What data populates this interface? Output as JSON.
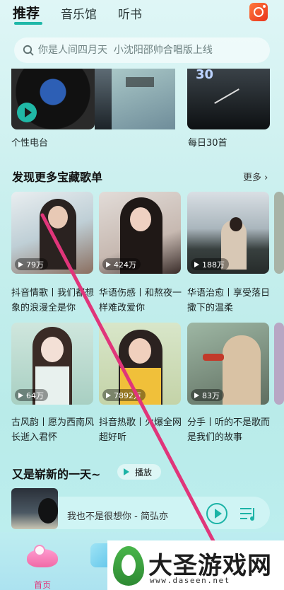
{
  "tabs": [
    "推荐",
    "音乐馆",
    "听书"
  ],
  "search": {
    "placeholder": "你是人间四月天  小沈阳邵帅合唱版上线"
  },
  "top_items": [
    {
      "label": "个性电台"
    },
    {
      "label": "每日30首",
      "cover_text": "30"
    }
  ],
  "section": {
    "title": "发现更多宝藏歌单",
    "more": "更多"
  },
  "playlists": [
    {
      "count": "79万",
      "title": "抖音情歌丨我们都想象的浪漫全是你"
    },
    {
      "count": "424万",
      "title": "华语伤感丨和熬夜一样难改爱你"
    },
    {
      "count": "188万",
      "title": "华语治愈丨享受落日撒下的温柔"
    },
    {
      "count": "64万",
      "title": "古风韵丨愿为西南风 长逝入君怀"
    },
    {
      "count": "7892万",
      "title": "抖音热歌丨火爆全网超好听"
    },
    {
      "count": "83万",
      "title": "分手丨听的不是歌而是我们的故事"
    }
  ],
  "section2": {
    "title": "又是崭新的一天~",
    "play": "播放"
  },
  "player": {
    "song": "我也不是很想你 - 简弘亦"
  },
  "nav": {
    "home": "首页"
  },
  "watermark": {
    "title": "大圣游戏网",
    "url": "www.daseen.net"
  },
  "colors": {
    "accent": "#1fb8a8",
    "bg": "#c9efee",
    "stroke": "#e0357a"
  }
}
